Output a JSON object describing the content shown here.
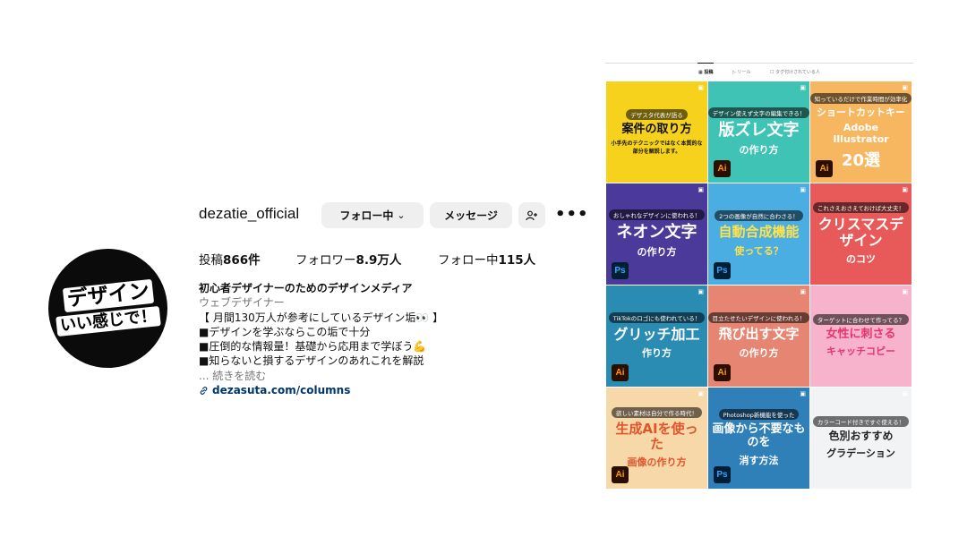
{
  "profile": {
    "username": "dezatie_official",
    "follow_button": "フォロー中",
    "message_button": "メッセージ",
    "more_icon": "•••",
    "avatar_line1": "デザイン",
    "avatar_line2": "いい感じで！",
    "stats": {
      "posts_label": "投稿",
      "posts_value": "866件",
      "followers_label": "フォロワー",
      "followers_value": "8.9万人",
      "following_label": "フォロー中",
      "following_value": "115人"
    },
    "bio": {
      "name": "初心者デザイナーのためのデザインメディア",
      "category": "ウェブデザイナー",
      "lines": [
        "【 月間130万人が参考にしているデザイン垢👀 】",
        "■デザインを学ぶならこの垢で十分",
        "■圧倒的な情報量！基礎から応用まで学ぼう💪",
        "■知らないと損するデザインのあれこれを解説"
      ],
      "more": "... 続きを読む",
      "link": "dezasuta.com/columns"
    }
  },
  "tabs": [
    {
      "label": "▦ 投稿",
      "active": true
    },
    {
      "label": "▷ リール",
      "active": false
    },
    {
      "label": "☐ タグ付けされている人",
      "active": false
    }
  ],
  "tiles": [
    {
      "top": "デザスタ代表が語る",
      "main": "案件の取り方",
      "sub": "小手先のテクニックではなく本質的な部分を解説します。",
      "bg": "#f6d21c",
      "fg": "#111",
      "badge": ""
    },
    {
      "top": "デザイン使えず文字の編集できる！",
      "main": "版ズレ文字",
      "sub": "の作り方",
      "bg": "#3fc3b4",
      "fg": "#ffffff",
      "badge": "Ai"
    },
    {
      "top": "知っているだけで作業時間が効率化",
      "main": "ショートカットキー",
      "sub": "Adobe Illustrator",
      "extra": "20選",
      "bg": "#f7b760",
      "fg": "#ffffff",
      "badge": "Ai"
    },
    {
      "top": "おしゃれなデザインに使われる！",
      "main": "ネオン文字",
      "sub": "の作り方",
      "bg": "#4b3a9a",
      "fg": "#ffffff",
      "badge": "Ps"
    },
    {
      "top": "2つの画像が自然に合わさる！",
      "main": "自動合成機能",
      "sub": "使ってる？",
      "bg": "#4aaee3",
      "fg": "#ffe14a",
      "badge": "Ps"
    },
    {
      "top": "これさえおさえておけば大丈夫！",
      "main": "クリスマスデザイン",
      "sub": "のコツ",
      "bg": "#e85a5a",
      "fg": "#ffffff",
      "badge": ""
    },
    {
      "top": "TikTokのロゴにも使われている！",
      "main": "グリッチ加工",
      "sub": "作り方",
      "bg": "#2a8bb3",
      "fg": "#ffffff",
      "badge": "Ai"
    },
    {
      "top": "目立たせたいデザインに使われる！",
      "main": "飛び出す文字",
      "sub": "の作り方",
      "bg": "#e68572",
      "fg": "#ffffff",
      "badge": "Ai"
    },
    {
      "top": "ターゲットに合わせて作ってる？",
      "main": "女性に刺さる",
      "sub": "キャッチコピー",
      "bg": "#f7b3cb",
      "fg": "#e6356e",
      "badge": ""
    },
    {
      "top": "欲しい素材は自分で作る時代！",
      "main": "生成AIを使った",
      "sub": "画像の作り方",
      "bg": "#f7d8a8",
      "fg": "#e1552c",
      "badge": "Ai"
    },
    {
      "top": "Photoshop新機能を使った",
      "main": "画像から不要なものを",
      "sub": "消す方法",
      "bg": "#2f7fb8",
      "fg": "#ffffff",
      "badge": "Ps"
    },
    {
      "top": "カラーコード付きですぐ使える！",
      "main": "色別おすすめ",
      "sub": "グラデーション",
      "bg": "#f2f3f5",
      "fg": "#222222",
      "badge": ""
    }
  ]
}
